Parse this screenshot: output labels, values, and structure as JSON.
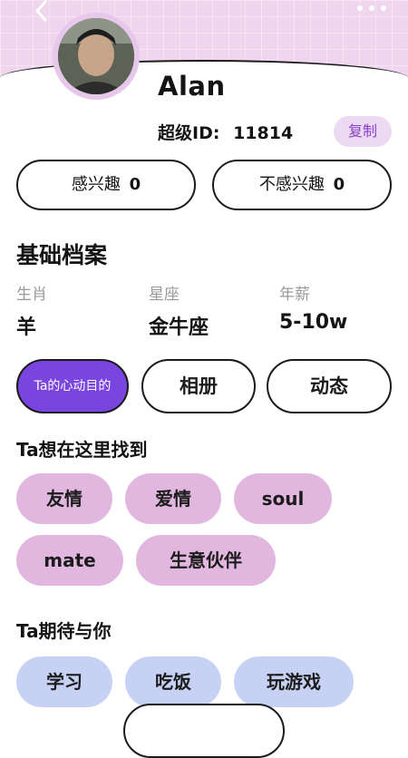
{
  "profile": {
    "name": "Alan",
    "id_label": "超级ID:",
    "id_value": "11814",
    "copy_label": "复制"
  },
  "interest": {
    "interested_label": "感兴趣",
    "interested_count": "0",
    "not_interested_label": "不感兴趣",
    "not_interested_count": "0"
  },
  "basic": {
    "title": "基础档案",
    "fields": [
      {
        "label": "生肖",
        "value": "羊"
      },
      {
        "label": "星座",
        "value": "金牛座"
      },
      {
        "label": "年薪",
        "value": "5-10w"
      }
    ]
  },
  "tabs": [
    {
      "label": "Ta的心动目的"
    },
    {
      "label": "相册"
    },
    {
      "label": "动态"
    }
  ],
  "looking_for": {
    "title": "Ta想在这里找到",
    "chips": [
      "友情",
      "爱情",
      "soul",
      "mate",
      "生意伙伴"
    ]
  },
  "expect": {
    "title": "Ta期待与你",
    "chips": [
      "学习",
      "吃饭",
      "玩游戏"
    ]
  },
  "colors": {
    "accent": "#7a44e0",
    "chip_purple": "#e1b7e0",
    "chip_blue": "#c7d1f3",
    "header": "#efd6ee"
  },
  "icons": {
    "back": "chevron-left-icon",
    "more": "more-dots-icon"
  }
}
